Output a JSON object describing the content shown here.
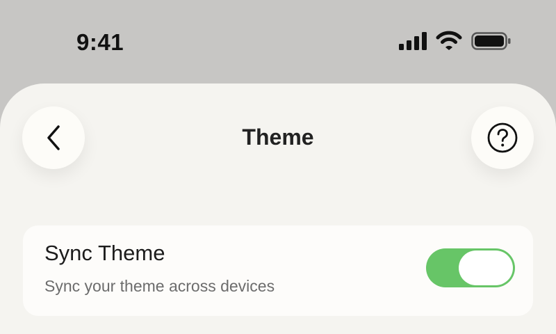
{
  "status_bar": {
    "time": "9:41",
    "icons": [
      "signal-icon",
      "wifi-icon",
      "battery-icon"
    ]
  },
  "header": {
    "title": "Theme",
    "back_icon": "chevron-left-icon",
    "help_icon": "question-circle-icon"
  },
  "settings": {
    "sync_theme": {
      "title": "Sync Theme",
      "subtitle": "Sync your theme across devices",
      "enabled": true
    }
  },
  "colors": {
    "toggle_on": "#67c567",
    "sheet_background": "#f5f4f0",
    "status_background": "#c7c6c4"
  }
}
